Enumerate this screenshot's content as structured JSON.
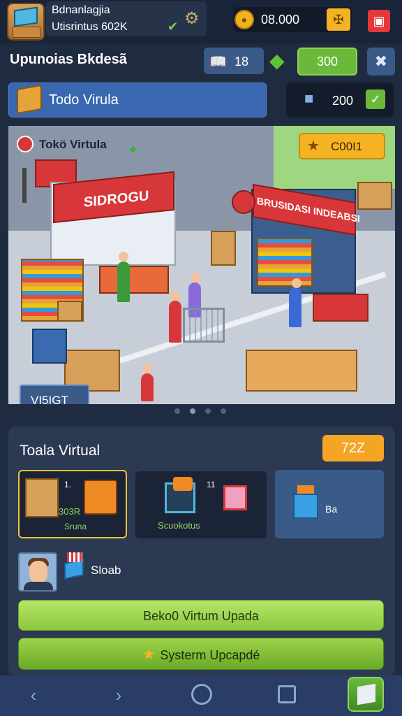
{
  "header": {
    "title_line1": "Bdnanlagjia",
    "title_line2": "Utisrintus 602K",
    "leaf_icon": "leaf-icon",
    "gear_icon": "gear-icon",
    "coin_value": "08.000",
    "coin_icon": "coin-icon",
    "pickaxe_icon": "pickaxe-icon",
    "menu_icon": "menu-icon"
  },
  "subheader": {
    "title": "Upunoias Bkdesã",
    "book_value": "18",
    "gem_icon": "gem-icon",
    "green_value": "300",
    "tools_icon": "tools-icon"
  },
  "store_bar": {
    "label": "Todo Virula",
    "counter_value": "200",
    "check_icon": "check-icon"
  },
  "scene": {
    "store_label": "Tokö Virtula",
    "star_value": "C00I1",
    "sign_left": "SIDROGU",
    "sign_right": "BRUSIDASI INDEABSI",
    "visit_label": "VI5IGT",
    "pages": 4,
    "active_page": 1
  },
  "panel": {
    "title": "Toala Virtual",
    "badge": "72Z",
    "cards": [
      {
        "num": "1.",
        "text1": "303R",
        "text2": "Sruna"
      },
      {
        "num": "11",
        "text": "Scuokotus"
      },
      {
        "text": "Ba"
      }
    ],
    "avatar_label": "Sloab",
    "button1": "Beko0 Virtum Upada",
    "button2": "Systerm Upcapdé"
  },
  "navbar": {
    "back_icon": "chevron-left-icon",
    "forward_icon": "chevron-right-icon",
    "home_icon": "home-circle-icon",
    "recent_icon": "recent-apps-icon",
    "app_icon": "store-app-icon"
  },
  "colors": {
    "background": "#1f2b40",
    "accent_green": "#6ab93b",
    "accent_orange": "#f5a524",
    "accent_blue": "#3967b0",
    "accent_red": "#e3393b"
  }
}
